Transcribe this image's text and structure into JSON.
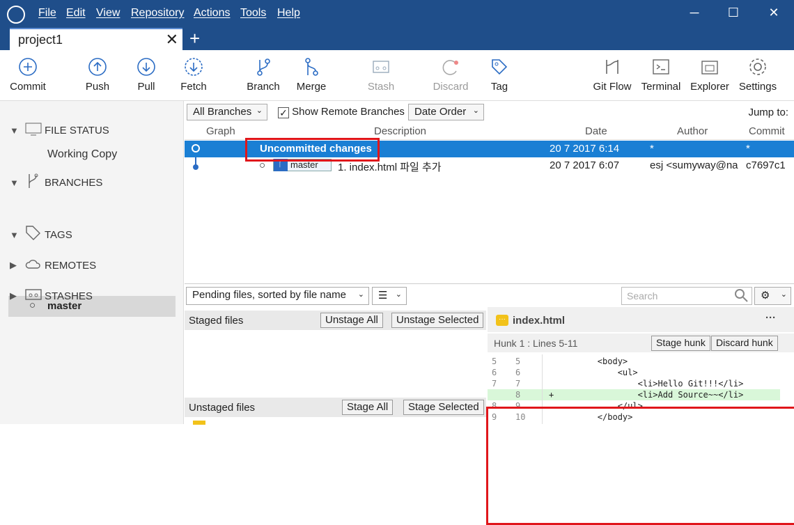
{
  "menu": {
    "file": "File",
    "edit": "Edit",
    "view": "View",
    "repository": "Repository",
    "actions": "Actions",
    "tools": "Tools",
    "help": "Help"
  },
  "window": {
    "minimize": "─",
    "maximize": "☐",
    "close": "✕"
  },
  "tab": {
    "label": "project1",
    "close": "✕",
    "add": "+"
  },
  "toolbar": {
    "commit": "Commit",
    "push": "Push",
    "pull": "Pull",
    "fetch": "Fetch",
    "branch": "Branch",
    "merge": "Merge",
    "stash": "Stash",
    "discard": "Discard",
    "tag": "Tag",
    "gitflow": "Git Flow",
    "terminal": "Terminal",
    "explorer": "Explorer",
    "settings": "Settings"
  },
  "sidebar": {
    "file_status": "FILE STATUS",
    "working_copy": "Working Copy",
    "branches": "BRANCHES",
    "master": "master",
    "tags": "TAGS",
    "remotes": "REMOTES",
    "stashes": "STASHES"
  },
  "filters": {
    "branches": "All Branches",
    "show_remote": "Show Remote Branches",
    "show_remote_checked": true,
    "order": "Date Order",
    "jump_to": "Jump to:"
  },
  "columns": {
    "graph": "Graph",
    "description": "Description",
    "date": "Date",
    "author": "Author",
    "commit": "Commit"
  },
  "commits": [
    {
      "description": "Uncommitted changes",
      "date": "20 7 2017 6:14",
      "author": "*",
      "commit": "*"
    },
    {
      "branch": "master",
      "description": "1. index.html 파일 추가",
      "date": "20 7 2017 6:07",
      "author": "esj <sumyway@na",
      "commit": "c7697c1"
    }
  ],
  "pending": {
    "sort": "Pending files, sorted by file name",
    "search_placeholder": "Search"
  },
  "staged": {
    "title": "Staged files",
    "unstage_all": "Unstage All",
    "unstage_selected": "Unstage Selected"
  },
  "unstaged": {
    "title": "Unstaged files",
    "stage_all": "Stage All",
    "stage_selected": "Stage Selected"
  },
  "diff": {
    "file": "index.html",
    "more": "···",
    "hunk": "Hunk 1 : Lines 5-11",
    "stage_hunk": "Stage hunk",
    "discard_hunk": "Discard hunk",
    "lines": [
      {
        "old": "5",
        "new": "5",
        "mark": "",
        "code": "        <body>"
      },
      {
        "old": "6",
        "new": "6",
        "mark": "",
        "code": "            <ul>"
      },
      {
        "old": "7",
        "new": "7",
        "mark": "",
        "code": "                <li>Hello Git!!!</li>"
      },
      {
        "old": "",
        "new": "8",
        "mark": "+",
        "code": "                <li>Add Source~~</li>"
      },
      {
        "old": "8",
        "new": "9",
        "mark": "",
        "code": "            </ul>"
      },
      {
        "old": "9",
        "new": "10",
        "mark": "",
        "code": "        </body>"
      }
    ]
  },
  "colors": {
    "titlebar": "#1f4e8a",
    "selection": "#1a7fd4",
    "highlight_box": "#e0161b",
    "added_line": "#d9f7d9"
  }
}
